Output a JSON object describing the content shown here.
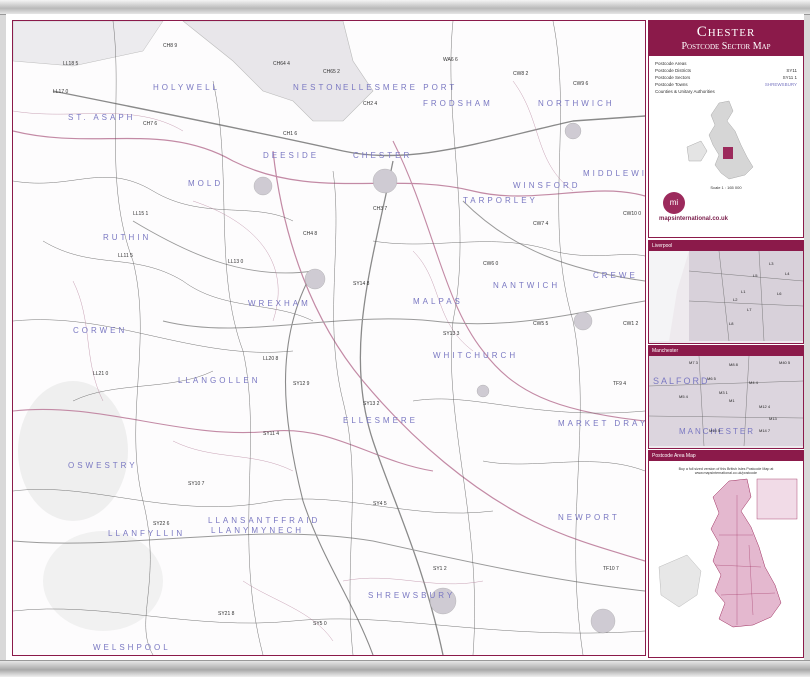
{
  "title": {
    "line1": "Chester",
    "line2": "Postcode Sector Map"
  },
  "legend": [
    {
      "label": "Postcode Areas",
      "sample": ""
    },
    {
      "label": "Postcode Districts",
      "sample": "SY11"
    },
    {
      "label": "Postcode Sectors",
      "sample": "SY11 1"
    },
    {
      "label": "Postcode Towns",
      "sample": "SHREWSBURY"
    },
    {
      "label": "Counties & Unitary Authorities",
      "sample": ""
    }
  ],
  "scale_text": "Scale 1 : 165 000",
  "brand": {
    "logo": "mi",
    "name": "mapsinternational.co.uk"
  },
  "insets": {
    "liverpool": "Liverpool",
    "manchester": "Manchester",
    "area_map": "Postcode Area Map",
    "area_map_note": "Buy a full sized version of this British Isles Postcode Map at www.mapsinternational.co.uk/postcode"
  },
  "towns": [
    {
      "name": "HOLYWELL",
      "cls": ""
    },
    {
      "name": "ST. ASAPH",
      "cls": ""
    },
    {
      "name": "NESTON",
      "cls": ""
    },
    {
      "name": "ELLESMERE PORT",
      "cls": ""
    },
    {
      "name": "FRODSHAM",
      "cls": ""
    },
    {
      "name": "NORTHWICH",
      "cls": ""
    },
    {
      "name": "DEESIDE",
      "cls": ""
    },
    {
      "name": "CHESTER",
      "cls": ""
    },
    {
      "name": "MOLD",
      "cls": ""
    },
    {
      "name": "WINSFORD",
      "cls": ""
    },
    {
      "name": "MIDDLEWICH",
      "cls": ""
    },
    {
      "name": "TARPORLEY",
      "cls": ""
    },
    {
      "name": "RUTHIN",
      "cls": ""
    },
    {
      "name": "WREXHAM",
      "cls": ""
    },
    {
      "name": "MALPAS",
      "cls": ""
    },
    {
      "name": "NANTWICH",
      "cls": ""
    },
    {
      "name": "CREWE",
      "cls": ""
    },
    {
      "name": "CORWEN",
      "cls": ""
    },
    {
      "name": "LLANGOLLEN",
      "cls": ""
    },
    {
      "name": "WHITCHURCH",
      "cls": ""
    },
    {
      "name": "ELLESMERE",
      "cls": ""
    },
    {
      "name": "MARKET DRAYTON",
      "cls": ""
    },
    {
      "name": "OSWESTRY",
      "cls": ""
    },
    {
      "name": "LLANSANTFFRAID",
      "cls": ""
    },
    {
      "name": "LLANYMYNECH",
      "cls": ""
    },
    {
      "name": "LLANFYLLIN",
      "cls": ""
    },
    {
      "name": "SHREWSBURY",
      "cls": ""
    },
    {
      "name": "NEWPORT",
      "cls": ""
    },
    {
      "name": "WELSHPOOL",
      "cls": ""
    }
  ],
  "sectors": [
    "CH8 9",
    "LL18 5",
    "LL17 0",
    "CH7 6",
    "CH64 4",
    "CH65 2",
    "CH2 4",
    "WA6 6",
    "CW8 2",
    "CW9 6",
    "CH1 6",
    "CH3 7",
    "CW6 0",
    "CW7 4",
    "CW10 0",
    "CH4 8",
    "LL15 1",
    "LL11 5",
    "LL13 0",
    "SY14 8",
    "SY13 3",
    "CW5 5",
    "CW1 2",
    "LL21 0",
    "LL20 8",
    "SY12 9",
    "SY13 2",
    "TF9 4",
    "SY11 4",
    "SY10 7",
    "SY22 6",
    "SY4 5",
    "SY1 2",
    "TF10 7",
    "SY21 8",
    "SY5 0"
  ],
  "inset_labels": {
    "liverpool": [
      "L3",
      "L5",
      "L6",
      "L7",
      "L8",
      "L4",
      "L1",
      "L2"
    ],
    "manchester": [
      "M7 3",
      "M8 8",
      "M40 5",
      "M6 5",
      "M5 4",
      "M1",
      "M12 4",
      "M13",
      "M15 5",
      "M14 7",
      "M4 4",
      "M3 1"
    ]
  },
  "colors": {
    "accent": "#8b1a4a",
    "town": "#7a78c2",
    "road": "#c38aa5"
  }
}
